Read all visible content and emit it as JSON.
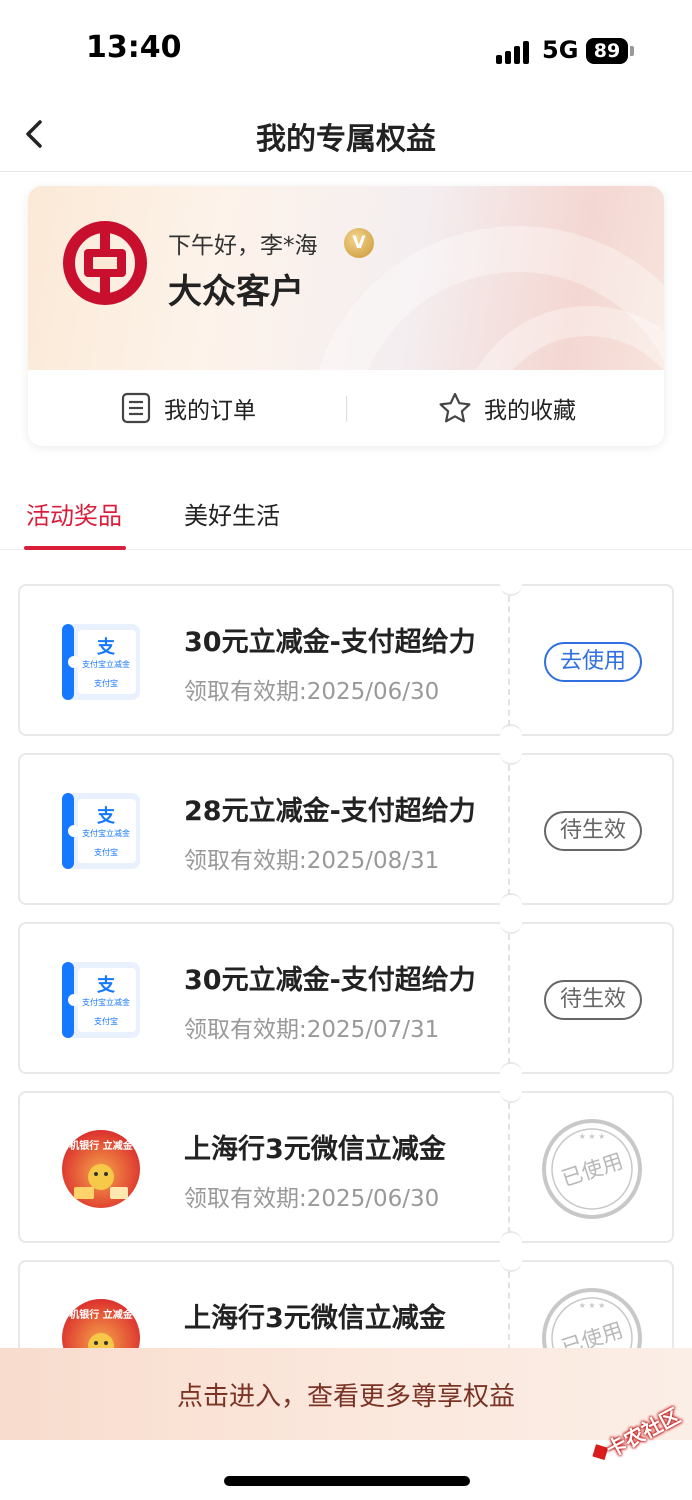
{
  "status_bar": {
    "time": "13:40",
    "network": "5G",
    "battery": "89"
  },
  "header": {
    "title": "我的专属权益"
  },
  "profile": {
    "greeting": "下午好，李*海",
    "vip_badge": "V",
    "level": "大众客户",
    "orders_label": "我的订单",
    "favorites_label": "我的收藏"
  },
  "tabs": [
    {
      "label": "活动奖品",
      "active": true
    },
    {
      "label": "美好生活",
      "active": false
    }
  ],
  "coupons": [
    {
      "title": "30元立减金-支付超给力",
      "date": "领取有效期:2025/06/30",
      "status": "去使用",
      "thumb": "alipay",
      "thumb_text": "支付宝立减金",
      "thumb_brand": "支付宝"
    },
    {
      "title": "28元立减金-支付超给力",
      "date": "领取有效期:2025/08/31",
      "status": "待生效",
      "thumb": "alipay",
      "thumb_text": "支付宝立减金",
      "thumb_brand": "支付宝"
    },
    {
      "title": "30元立减金-支付超给力",
      "date": "领取有效期:2025/07/31",
      "status": "待生效",
      "thumb": "alipay",
      "thumb_text": "支付宝立减金",
      "thumb_brand": "支付宝"
    },
    {
      "title": "上海行3元微信立减金",
      "date": "领取有效期:2025/06/30",
      "status": "已使用",
      "thumb": "wechat",
      "thumb_text": "行手机银行 立减金领取"
    },
    {
      "title": "上海行3元微信立减金",
      "date": "",
      "status": "已使用",
      "thumb": "wechat",
      "thumb_text": "行手机银行 立减金领取"
    }
  ],
  "banner": {
    "text": "点击进入，查看更多尊享权益"
  },
  "watermark": {
    "text": "卡农社区"
  },
  "colors": {
    "accent_red": "#d81e3a",
    "use_blue": "#2f6fe0",
    "banner_text": "#7a3325"
  }
}
